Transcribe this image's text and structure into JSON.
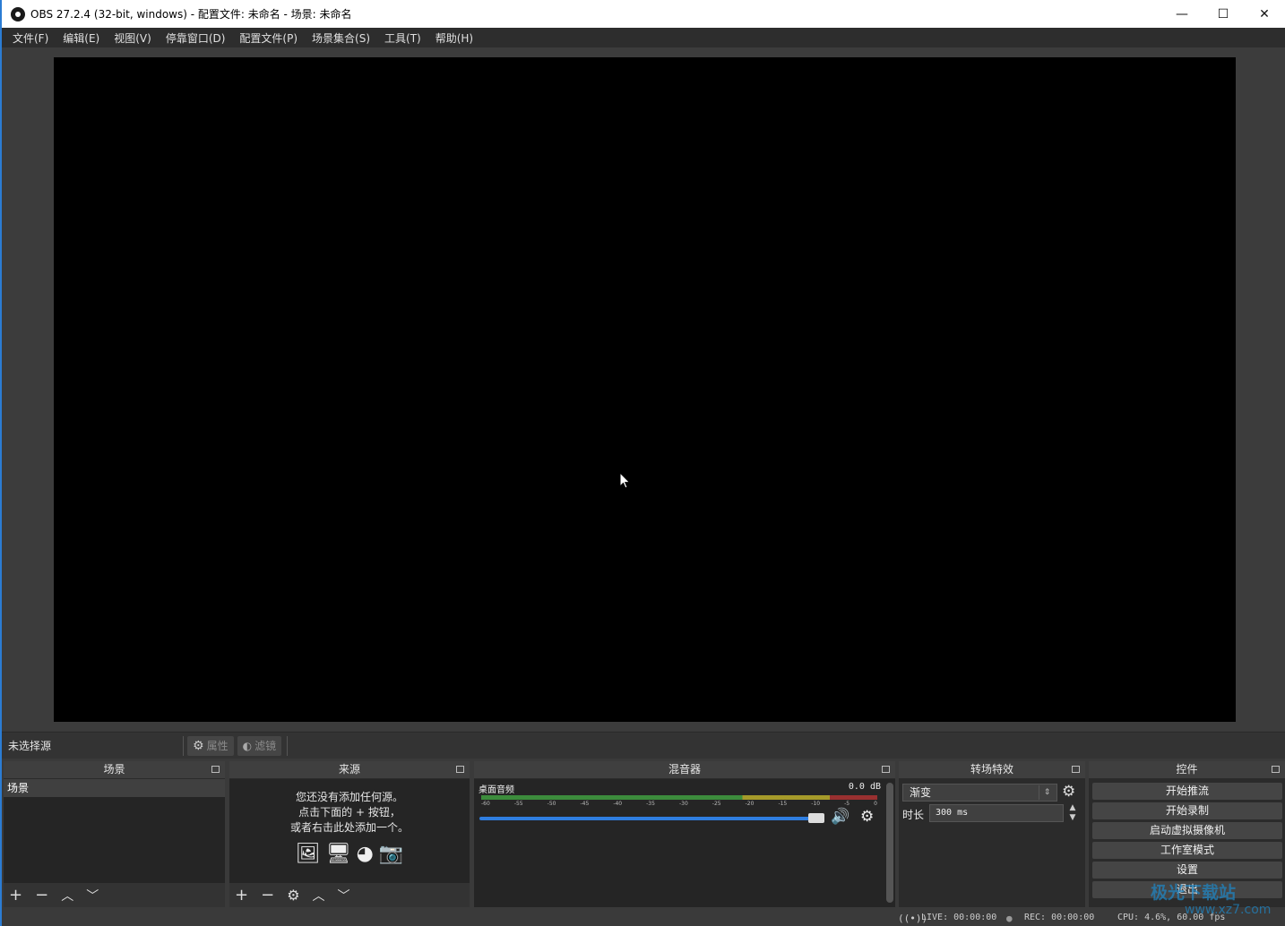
{
  "window": {
    "title": "OBS 27.2.4 (32-bit, windows) - 配置文件: 未命名 - 场景: 未命名",
    "minimize": "—",
    "maximize": "☐",
    "close": "✕"
  },
  "menu": [
    "文件(F)",
    "编辑(E)",
    "视图(V)",
    "停靠窗口(D)",
    "配置文件(P)",
    "场景集合(S)",
    "工具(T)",
    "帮助(H)"
  ],
  "source_toolbar": {
    "no_source": "未选择源",
    "properties": "属性",
    "filters": "滤镜"
  },
  "scenes": {
    "title": "场景",
    "items": [
      "场景"
    ]
  },
  "sources": {
    "title": "来源",
    "empty_line1": "您还没有添加任何源。",
    "empty_line2": "点击下面的 + 按钮，",
    "empty_line3": "或者右击此处添加一个。"
  },
  "mixer": {
    "title": "混音器",
    "track_name": "桌面音频",
    "db": "0.0 dB",
    "ticks": [
      "-60",
      "-55",
      "-50",
      "-45",
      "-40",
      "-35",
      "-30",
      "-25",
      "-20",
      "-15",
      "-10",
      "-5",
      "0"
    ]
  },
  "transitions": {
    "title": "转场特效",
    "selected": "渐变",
    "duration_label": "时长",
    "duration_value": "300 ms"
  },
  "controls": {
    "title": "控件",
    "buttons": [
      "开始推流",
      "开始录制",
      "启动虚拟摄像机",
      "工作室模式",
      "设置",
      "退出"
    ]
  },
  "status": {
    "live": "LIVE: 00:00:00",
    "rec": "REC: 00:00:00",
    "cpu": "CPU: 4.6%, 60.00 fps"
  },
  "watermark": {
    "text": "极光下载站",
    "url": "www.xz7.com"
  },
  "colors": {
    "accent": "#2b7cd3",
    "preview": "#000000",
    "panel": "#2b2b2b",
    "volume": "#2f7ee0"
  }
}
